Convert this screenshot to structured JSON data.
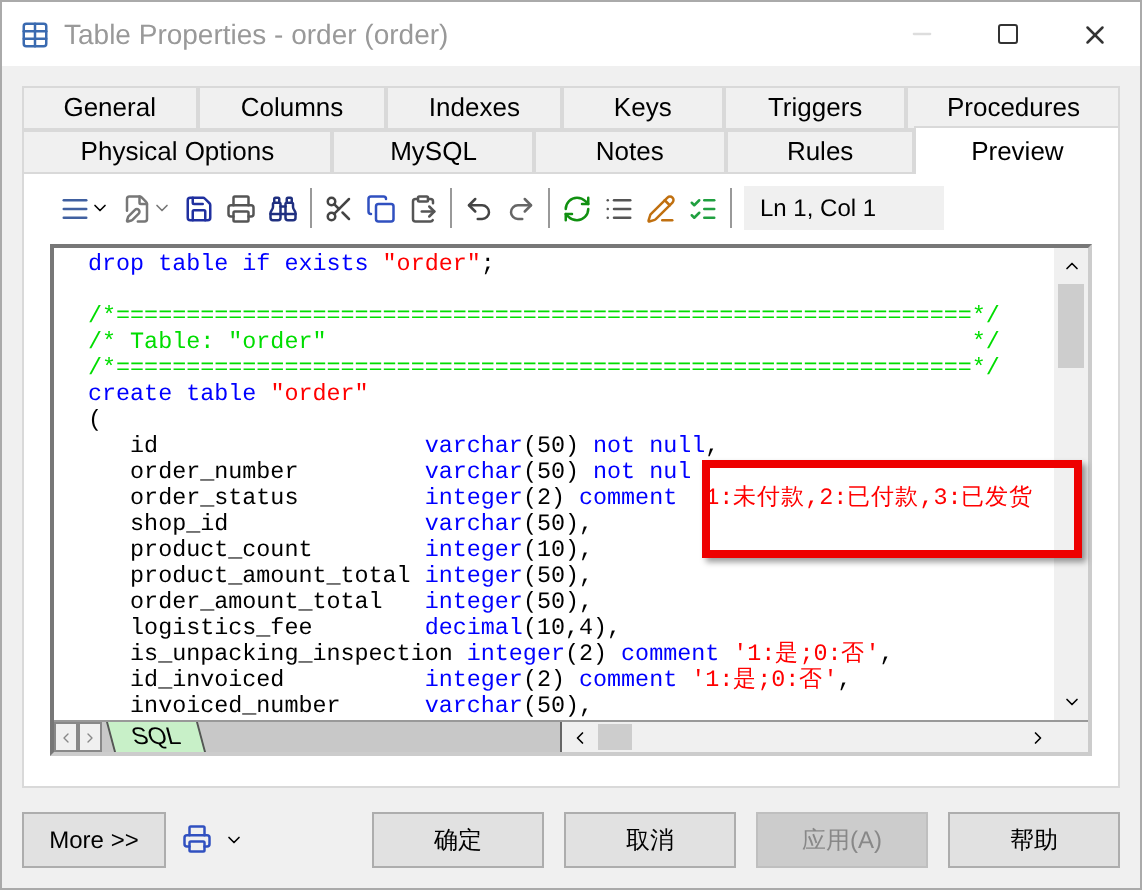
{
  "window": {
    "title": "Table Properties - order (order)"
  },
  "tab_rows": [
    [
      {
        "label": "General",
        "selected": false
      },
      {
        "label": "Columns",
        "selected": false
      },
      {
        "label": "Indexes",
        "selected": false
      },
      {
        "label": "Keys",
        "selected": false
      },
      {
        "label": "Triggers",
        "selected": false
      },
      {
        "label": "Procedures",
        "selected": false
      }
    ],
    [
      {
        "label": "Physical Options",
        "selected": false
      },
      {
        "label": "MySQL",
        "selected": false
      },
      {
        "label": "Notes",
        "selected": false
      },
      {
        "label": "Rules",
        "selected": false
      },
      {
        "label": "Preview",
        "selected": true
      }
    ]
  ],
  "toolbar": {
    "cursor_position": "Ln 1, Col 1"
  },
  "code_lines": [
    [
      {
        "kind": "keyword",
        "text": "drop table if exists "
      },
      {
        "kind": "string",
        "text": "\"order\""
      },
      {
        "kind": "plain",
        "text": ";"
      }
    ],
    [
      {
        "kind": "blank"
      }
    ],
    [
      {
        "kind": "comment",
        "text": "/*=============================================================*/"
      }
    ],
    [
      {
        "kind": "comment",
        "text": "/* Table: \"order\"                                              */"
      }
    ],
    [
      {
        "kind": "comment",
        "text": "/*=============================================================*/"
      }
    ],
    [
      {
        "kind": "keyword",
        "text": "create table "
      },
      {
        "kind": "string",
        "text": "\"order\""
      }
    ],
    [
      {
        "kind": "plain",
        "text": "("
      }
    ],
    [
      {
        "kind": "plain",
        "text": "   id                   "
      },
      {
        "kind": "keyword",
        "text": "varchar"
      },
      {
        "kind": "plain",
        "text": "(50) "
      },
      {
        "kind": "keyword",
        "text": "not null"
      },
      {
        "kind": "plain",
        "text": ","
      }
    ],
    [
      {
        "kind": "plain",
        "text": "   order_number         "
      },
      {
        "kind": "keyword",
        "text": "varchar"
      },
      {
        "kind": "plain",
        "text": "(50) "
      },
      {
        "kind": "keyword",
        "text": "not nul"
      }
    ],
    [
      {
        "kind": "plain",
        "text": "   order_status         "
      },
      {
        "kind": "keyword",
        "text": "integer"
      },
      {
        "kind": "plain",
        "text": "(2) "
      },
      {
        "kind": "keyword",
        "text": "comment  "
      },
      {
        "kind": "string",
        "text": "1:未付款,2:已付款,3:已发货"
      }
    ],
    [
      {
        "kind": "plain",
        "text": "   shop_id              "
      },
      {
        "kind": "keyword",
        "text": "varchar"
      },
      {
        "kind": "plain",
        "text": "(50),"
      }
    ],
    [
      {
        "kind": "plain",
        "text": "   product_count        "
      },
      {
        "kind": "keyword",
        "text": "integer"
      },
      {
        "kind": "plain",
        "text": "(10),"
      }
    ],
    [
      {
        "kind": "plain",
        "text": "   product_amount_total "
      },
      {
        "kind": "keyword",
        "text": "integer"
      },
      {
        "kind": "plain",
        "text": "(50),"
      }
    ],
    [
      {
        "kind": "plain",
        "text": "   order_amount_total   "
      },
      {
        "kind": "keyword",
        "text": "integer"
      },
      {
        "kind": "plain",
        "text": "(50),"
      }
    ],
    [
      {
        "kind": "plain",
        "text": "   logistics_fee        "
      },
      {
        "kind": "keyword",
        "text": "decimal"
      },
      {
        "kind": "plain",
        "text": "(10,4),"
      }
    ],
    [
      {
        "kind": "plain",
        "text": "   is_unpacking_inspection "
      },
      {
        "kind": "keyword",
        "text": "integer"
      },
      {
        "kind": "plain",
        "text": "(2) "
      },
      {
        "kind": "keyword",
        "text": "comment "
      },
      {
        "kind": "string",
        "text": "'1:是;0:否'"
      },
      {
        "kind": "plain",
        "text": ","
      }
    ],
    [
      {
        "kind": "plain",
        "text": "   id_invoiced          "
      },
      {
        "kind": "keyword",
        "text": "integer"
      },
      {
        "kind": "plain",
        "text": "(2) "
      },
      {
        "kind": "keyword",
        "text": "comment "
      },
      {
        "kind": "string",
        "text": "'1:是;0:否'"
      },
      {
        "kind": "plain",
        "text": ","
      }
    ],
    [
      {
        "kind": "plain",
        "text": "   invoiced_number      "
      },
      {
        "kind": "keyword",
        "text": "varchar"
      },
      {
        "kind": "plain",
        "text": "(50),"
      }
    ]
  ],
  "sheet_tab": {
    "label": "SQL",
    "selected": true
  },
  "more_button": "More >>",
  "buttons": [
    {
      "label": "确定",
      "disabled": false
    },
    {
      "label": "取消",
      "disabled": false
    },
    {
      "label": "应用(A)",
      "disabled": true
    },
    {
      "label": "帮助",
      "disabled": false
    }
  ]
}
